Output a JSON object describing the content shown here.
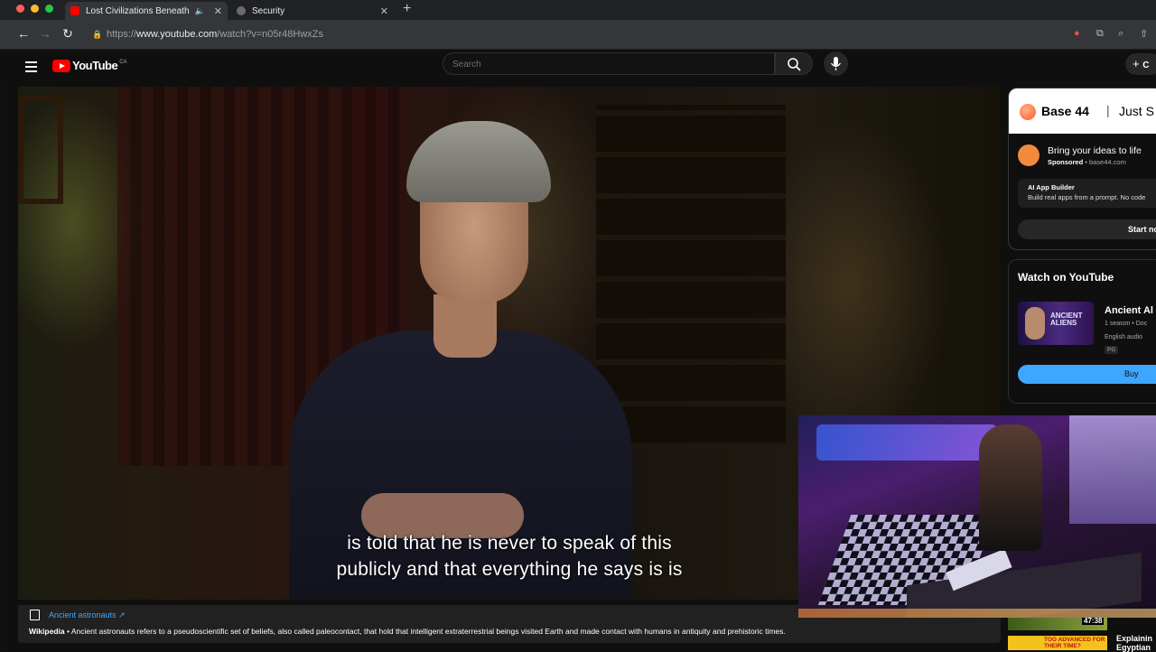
{
  "browser": {
    "tabs": [
      {
        "title": "Lost Civilizations Beneath",
        "favicon_color": "#ff0000",
        "active": true
      },
      {
        "title": "Security",
        "favicon_color": "#8a8a8a",
        "active": false
      }
    ],
    "new_tab_symbol": "+",
    "url_scheme": "https://",
    "url_host": "www.youtube.com",
    "url_path": "/watch?v=n05r48HwxZs"
  },
  "youtube": {
    "logo_text": "YouTube",
    "country_code": "CA",
    "search_placeholder": "Search",
    "create_label": "C"
  },
  "video": {
    "subtitle_line1": "is told that he is never to speak of this",
    "subtitle_line2": "publicly and that everything he says is is"
  },
  "info_panel": {
    "link_text": "Ancient astronauts ↗",
    "source": "Wikipedia",
    "description": " • Ancient astronauts refers to a pseudoscientific set of beliefs, also called paleocontact, that hold that intelligent extraterrestrial beings visited Earth and made contact with humans in antiquity and prehistoric times."
  },
  "ad": {
    "brand": "Base 44",
    "separator": "|",
    "tagline": "Just S",
    "title": "Bring your ideas to life",
    "sponsored": "Sponsored",
    "domain": " • base44.com",
    "box_heading": "AI App Builder",
    "box_text": "Build real apps from a prompt. No code",
    "cta": "Start now"
  },
  "watch_on_youtube": {
    "heading": "Watch on YouTube",
    "thumb_text_line1": "ANCIENT",
    "thumb_text_line2": "ALIENS",
    "show_title": "Ancient Al",
    "meta1": "1 season • Doc",
    "meta2": "English audio",
    "rating": "PG",
    "buy_label": "Buy"
  },
  "up_next": {
    "duration": "47:38",
    "thumb_text": "TOO ADVANCED FOR THEIR TIME?",
    "title_line1": "Explainin",
    "title_line2": "Egyptian"
  },
  "colors": {
    "youtube_red": "#ff0000",
    "link_blue": "#3ea6ff",
    "background": "#0f0f0f"
  }
}
